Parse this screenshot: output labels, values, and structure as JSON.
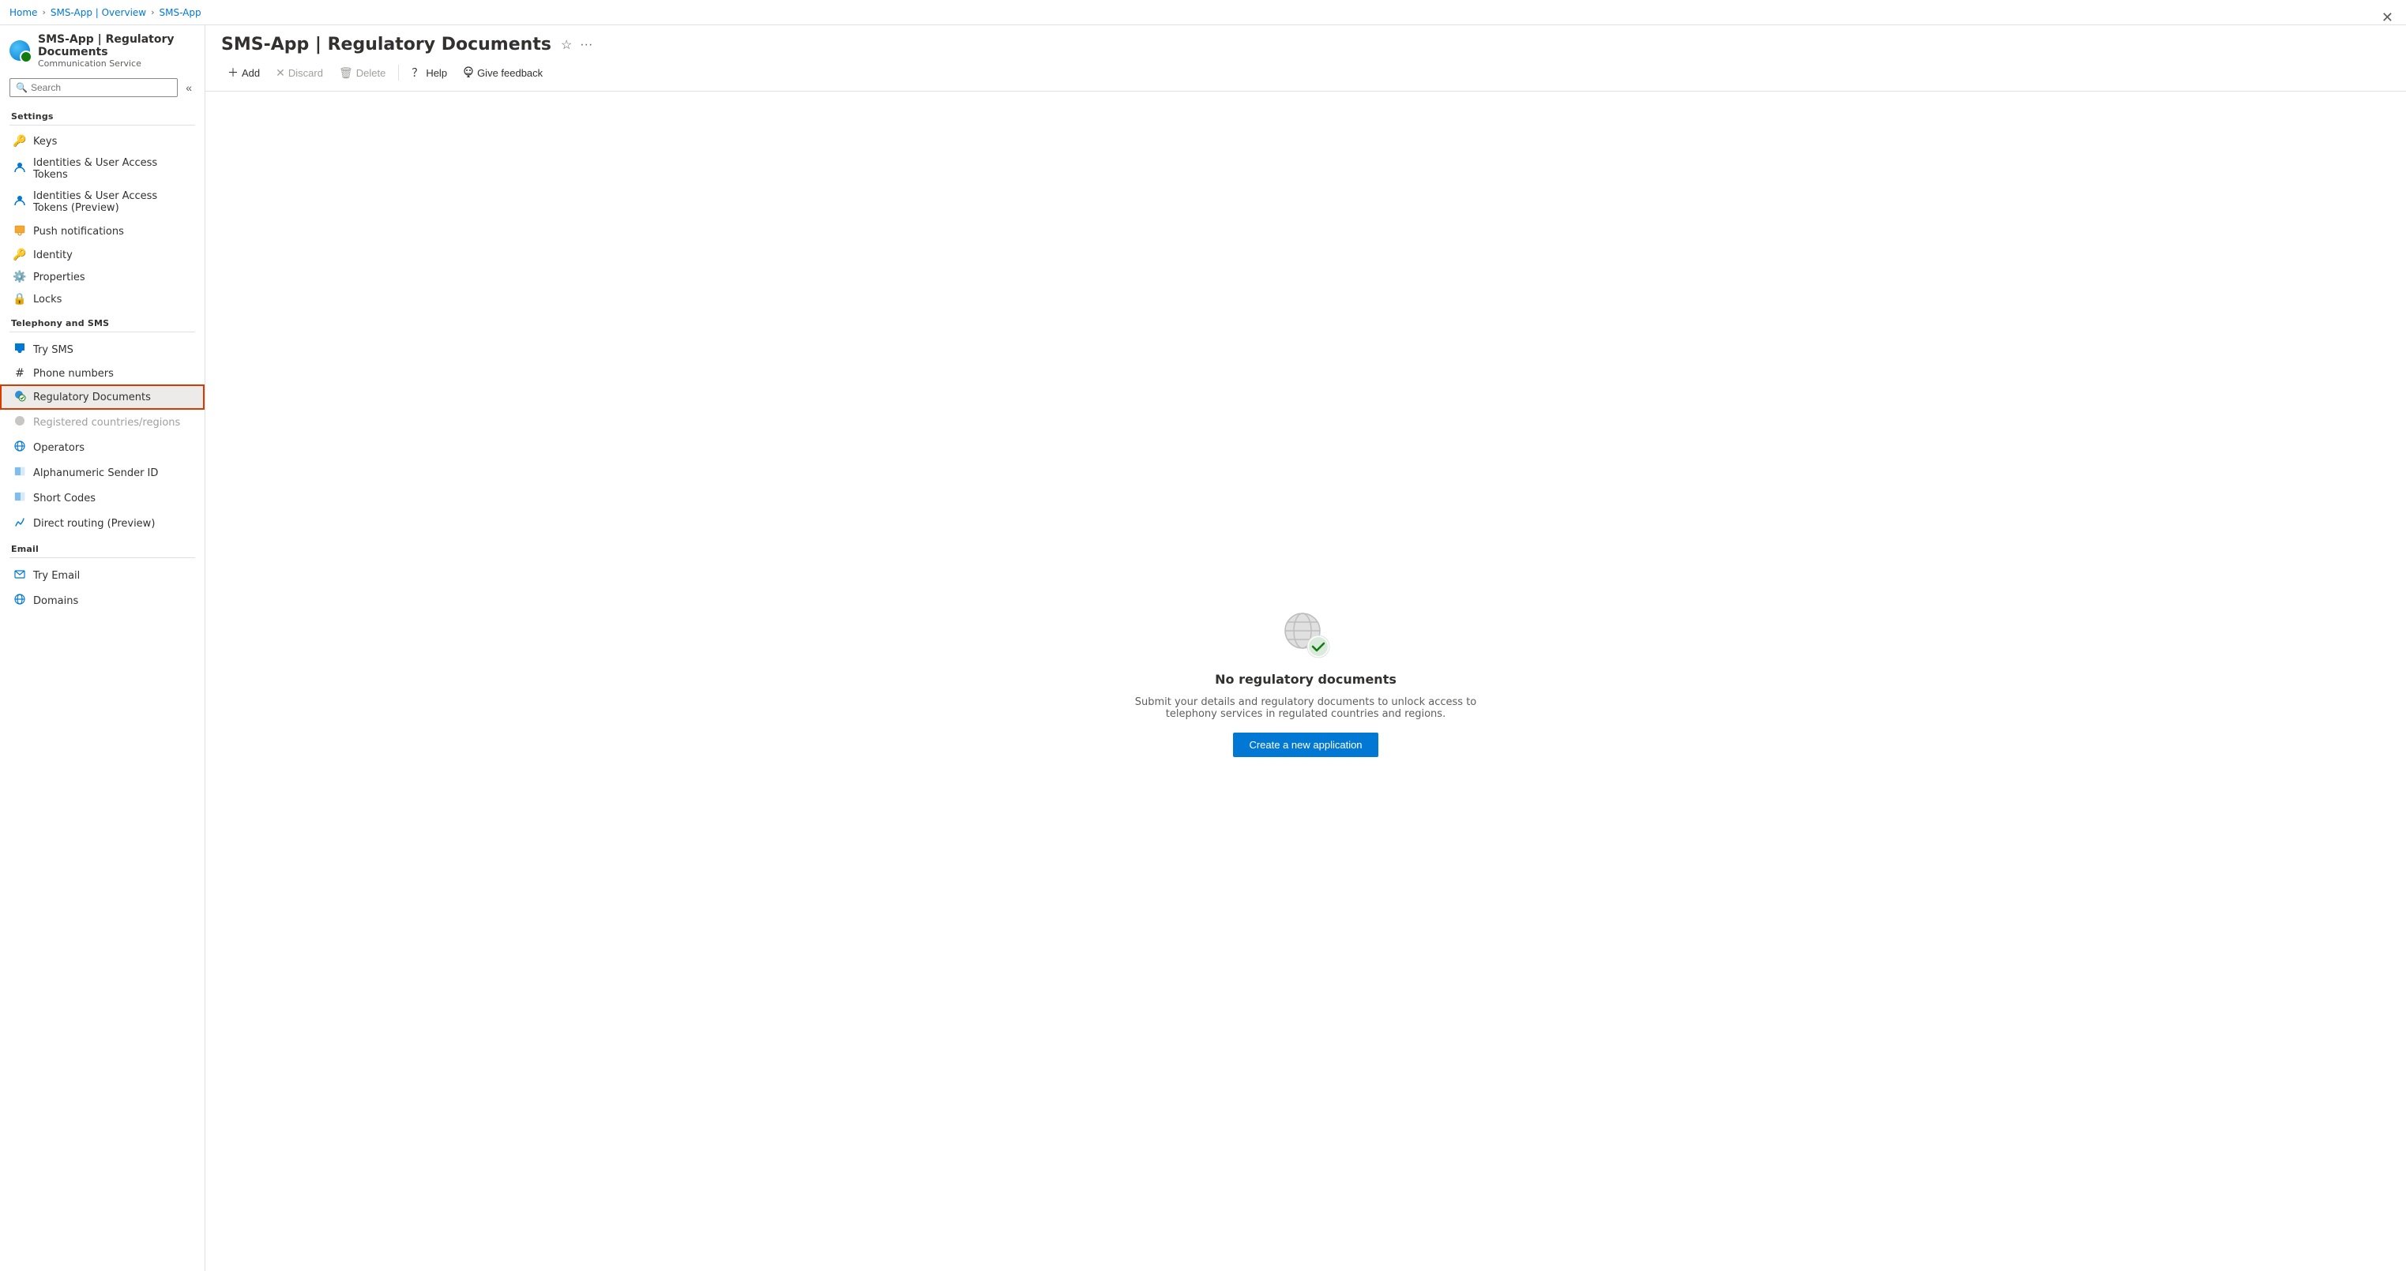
{
  "breadcrumb": {
    "items": [
      "Home",
      "SMS-App | Overview",
      "SMS-App"
    ]
  },
  "app": {
    "title": "SMS-App | Regulatory Documents",
    "subtitle": "Communication Service"
  },
  "sidebar": {
    "search_placeholder": "Search",
    "collapse_icon": "«",
    "sections": [
      {
        "label": "Settings",
        "items": [
          {
            "id": "keys",
            "label": "Keys",
            "icon": "🔑"
          },
          {
            "id": "identities-tokens",
            "label": "Identities & User Access Tokens",
            "icon": "👤"
          },
          {
            "id": "identities-tokens-preview",
            "label": "Identities & User Access Tokens (Preview)",
            "icon": "👤"
          },
          {
            "id": "push-notifications",
            "label": "Push notifications",
            "icon": "🖥"
          },
          {
            "id": "identity",
            "label": "Identity",
            "icon": "🔑"
          },
          {
            "id": "properties",
            "label": "Properties",
            "icon": "⚙"
          },
          {
            "id": "locks",
            "label": "Locks",
            "icon": "🔒"
          }
        ]
      },
      {
        "label": "Telephony and SMS",
        "items": [
          {
            "id": "try-sms",
            "label": "Try SMS",
            "icon": "✉"
          },
          {
            "id": "phone-numbers",
            "label": "Phone numbers",
            "icon": "#"
          },
          {
            "id": "regulatory-documents",
            "label": "Regulatory Documents",
            "icon": "🌐",
            "active": true
          },
          {
            "id": "registered-countries",
            "label": "Registered countries/regions",
            "icon": "🌐",
            "disabled": true
          },
          {
            "id": "operators",
            "label": "Operators",
            "icon": "📡"
          },
          {
            "id": "alphanumeric-sender",
            "label": "Alphanumeric Sender ID",
            "icon": "📋"
          },
          {
            "id": "short-codes",
            "label": "Short Codes",
            "icon": "📋"
          },
          {
            "id": "direct-routing",
            "label": "Direct routing (Preview)",
            "icon": "📞"
          }
        ]
      },
      {
        "label": "Email",
        "items": [
          {
            "id": "try-email",
            "label": "Try Email",
            "icon": "✈"
          },
          {
            "id": "domains",
            "label": "Domains",
            "icon": "🌐"
          }
        ]
      }
    ]
  },
  "toolbar": {
    "add_label": "Add",
    "discard_label": "Discard",
    "delete_label": "Delete",
    "help_label": "Help",
    "give_feedback_label": "Give feedback"
  },
  "content": {
    "empty_title": "No regulatory documents",
    "empty_subtitle": "Submit your details and regulatory documents to unlock access to telephony services in regulated countries and regions.",
    "create_button_label": "Create a new application"
  }
}
